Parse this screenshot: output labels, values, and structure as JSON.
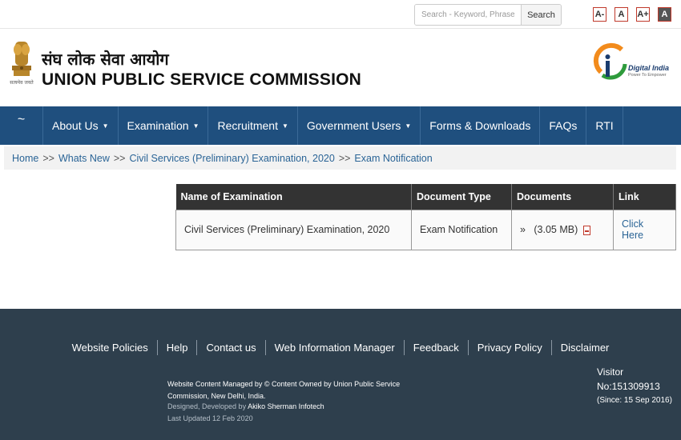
{
  "topbar": {
    "search_placeholder": "Search - Keyword, Phrase",
    "search_button": "Search",
    "font_sizes": [
      "A-",
      "A",
      "A+",
      "A"
    ]
  },
  "header": {
    "hindi_title": "संघ लोक सेवा आयोग",
    "english_title": "UNION PUBLIC SERVICE COMMISSION",
    "digital_india": "Digital India",
    "digital_india_tagline": "Power To Empower",
    "emblem_motto": "सत्यमेव जयते"
  },
  "nav": {
    "home": "~",
    "items": [
      {
        "label": "About Us",
        "dropdown": true
      },
      {
        "label": "Examination",
        "dropdown": true
      },
      {
        "label": "Recruitment",
        "dropdown": true
      },
      {
        "label": "Government Users",
        "dropdown": true
      },
      {
        "label": "Forms & Downloads",
        "dropdown": false
      },
      {
        "label": "FAQs",
        "dropdown": false
      },
      {
        "label": "RTI",
        "dropdown": false
      }
    ],
    "caret": "▼"
  },
  "breadcrumb": {
    "items": [
      "Home",
      "Whats New",
      "Civil Services (Preliminary) Examination, 2020",
      "Exam Notification"
    ],
    "separator": ">>"
  },
  "table": {
    "headers": [
      "Name of Examination",
      "Document Type",
      "Documents",
      "Link"
    ],
    "rows": [
      {
        "name": "Civil Services (Preliminary) Examination, 2020",
        "type": "Exam Notification",
        "doc_prefix": "»",
        "doc_size": "(3.05 MB)",
        "link": "Click Here"
      }
    ]
  },
  "footer": {
    "links": [
      "Website Policies",
      "Help",
      "Contact us",
      "Web Information Manager",
      "Feedback",
      "Privacy Policy",
      "Disclaimer"
    ],
    "managed": "Website Content Managed by © Content Owned by Union Public Service Commission, New Delhi, India.",
    "designed_prefix": "Designed, Developed by",
    "designed_by": "Akiko Sherman Infotech",
    "last_updated": "Last Updated 12 Feb 2020",
    "visitor_label": "Visitor",
    "visitor_no": "No:151309913",
    "visitor_since": "(Since: 15 Sep 2016)"
  },
  "colors": {
    "nav_bg": "#1f4f7e",
    "footer_bg": "#2e3f4d",
    "table_header_bg": "#333333",
    "link": "#2a6496"
  }
}
